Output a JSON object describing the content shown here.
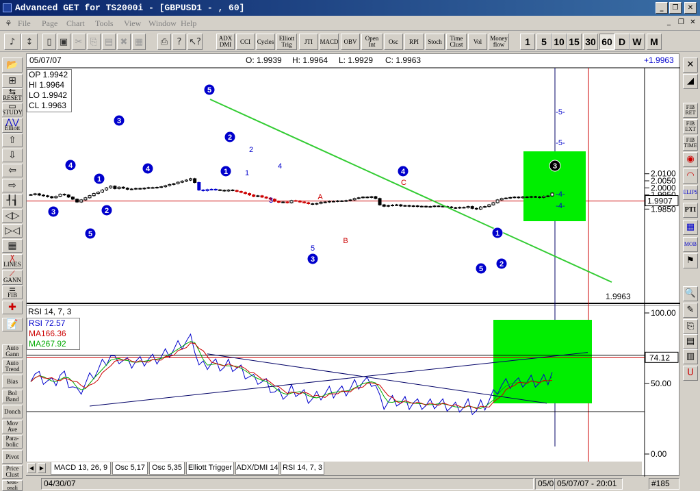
{
  "window": {
    "title": "Advanced GET for TS2000i - [GBPUSD1 - , 60]"
  },
  "menu": [
    "File",
    "Page",
    "Chart",
    "Tools",
    "View",
    "Window",
    "Help"
  ],
  "toolbar": {
    "study_buttons": [
      "ADX\nDMI",
      "CCI",
      "Cycles",
      "Elliott\nTrig",
      "JTI",
      "MACD",
      "OBV",
      "Open\nInt",
      "Osc",
      "RPI",
      "Stoch",
      "Time\nClust",
      "Vol",
      "Money\nflow"
    ],
    "intervals": [
      "1",
      "5",
      "10",
      "15",
      "30",
      "60",
      "D",
      "W",
      "M"
    ],
    "active_interval": "60"
  },
  "left_tools": [
    "Elliott",
    "RESET",
    "STUDY",
    "LINES",
    "GANN",
    "FIB",
    "Auto\nGann",
    "Auto\nTrend",
    "Bias",
    "Bol\nBand",
    "Donch",
    "Mov\nAve",
    "Para-\nbolic",
    "Pivot",
    "Price\nClust",
    "Seas-\nonali"
  ],
  "right_tools": [
    "FIB\nRET",
    "FIB\nEXT",
    "FIB\nTIME",
    "ELIPS",
    "PTI",
    "MOB"
  ],
  "price_panel": {
    "date": "05/07/07",
    "ohlc": {
      "o": "O: 1.9939",
      "h": "H: 1.9964",
      "l": "L: 1.9929",
      "c": "C: 1.9963"
    },
    "last": "+1.9963",
    "box": {
      "op": "OP 1.9942",
      "hi": "HI 1.9964",
      "lo": "LO 1.9942",
      "cl": "CL 1.9963"
    },
    "axis_ticks": [
      "2.0100",
      "2.0050",
      "2.0000",
      "1.9950",
      "1.9900",
      "1.9850"
    ],
    "axis_values": [
      2.01,
      2.005,
      2.0,
      1.995,
      1.99,
      1.985
    ],
    "marker_label": "1.9907",
    "marker_value": 1.9907,
    "close_label": "1.9963",
    "colors": {
      "up": "#000000",
      "down": "#cc0000",
      "impulse": "#0000cc",
      "trend": "#33cc33",
      "zone": "#00ee00",
      "hline": "#cc0000",
      "vline": "#000066",
      "vline2": "#cc0000"
    }
  },
  "elliott": {
    "circles": [
      "3",
      "4",
      "1",
      "5",
      "2",
      "3",
      "4",
      "5",
      "2",
      "1",
      "4",
      "1",
      "5",
      "2",
      "3",
      "3"
    ],
    "small": [
      "2",
      "1",
      "4",
      "3",
      "5",
      "-5-",
      "-5-",
      "-4-",
      "-4-"
    ],
    "red": [
      "A",
      "B",
      "C"
    ]
  },
  "rsi_panel": {
    "title": "RSI 14, 7, 3",
    "rsi": "RSI  72.57",
    "ma1": "MA166.36",
    "ma2": "MA267.92",
    "axis_ticks": [
      "100.00",
      "50.00",
      "0.00"
    ],
    "axis_values": [
      100,
      50,
      0
    ],
    "marker_label": "74.12",
    "marker_value": 74.12,
    "colors": {
      "rsi": "#0000cc",
      "ma1": "#cc0000",
      "ma2": "#00aa00"
    }
  },
  "tabs": [
    "MACD 13, 26, 9",
    "Osc 5,17",
    "Osc 5,35",
    "Elliott Trigger",
    "ADX/DMI 14",
    "RSI 14, 7, 3"
  ],
  "status": {
    "start": "04/30/07",
    "mid": "05/0",
    "datetime": "05/07/07 - 20:01",
    "bar": "#185"
  }
}
